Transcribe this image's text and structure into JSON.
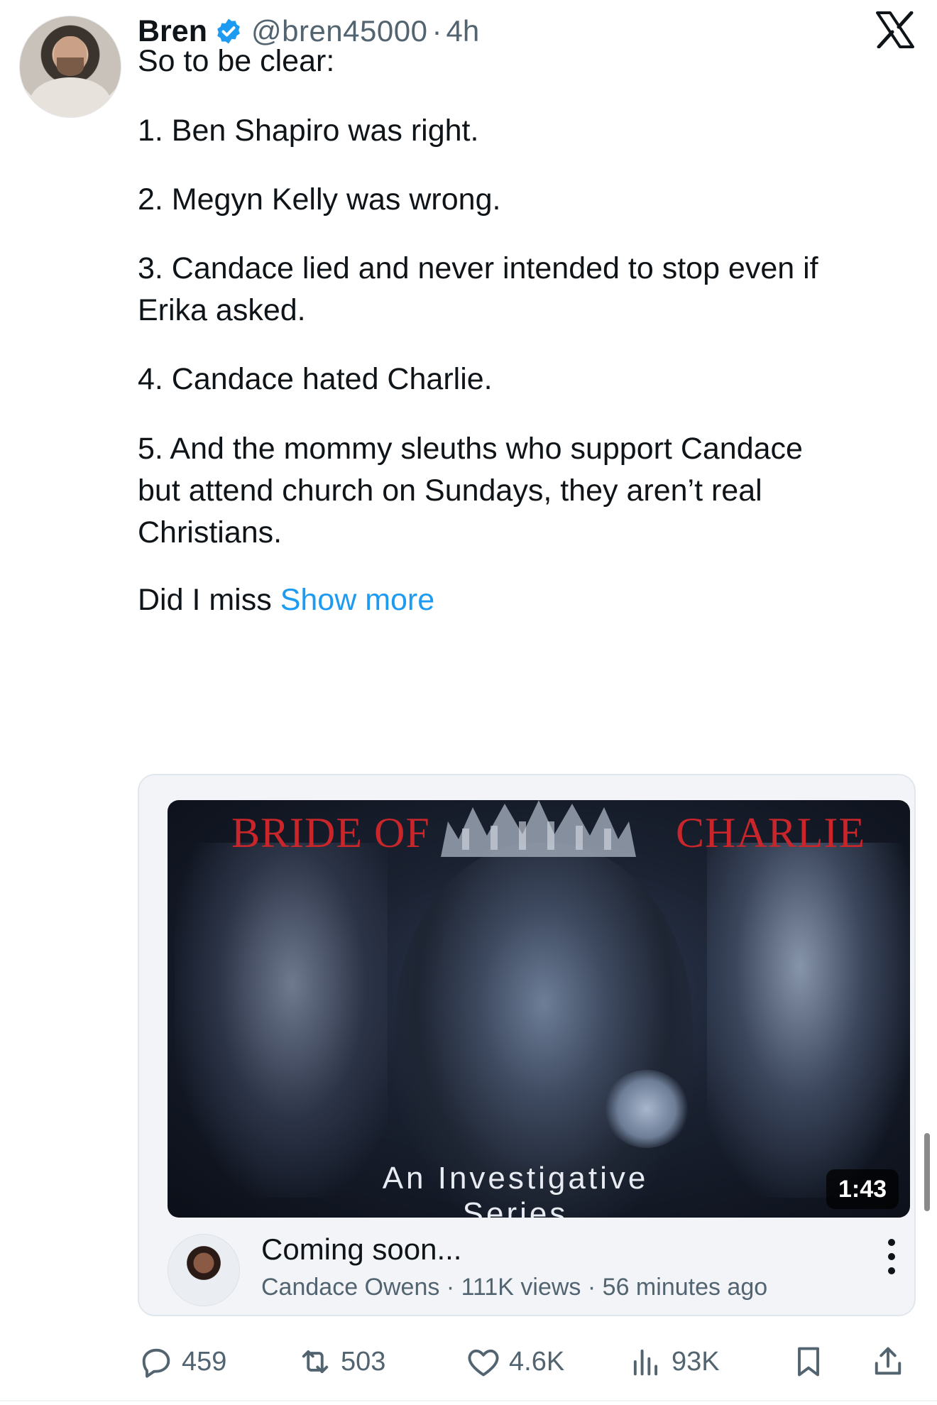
{
  "author": {
    "name": "Bren",
    "handle": "@bren45000",
    "separator": "·",
    "time": "4h",
    "verified": true
  },
  "brand": {
    "logo_icon": "x-logo-icon"
  },
  "tweet": {
    "lines": [
      "So to be clear:",
      "1. Ben Shapiro was right.",
      "2. Megyn Kelly was wrong.",
      "3. Candace lied and never intended to stop even if",
      "Erika asked.",
      "4. Candace hated Charlie.",
      "5. And the mommy sleuths who support Candace",
      "but attend church on Sundays, they aren’t real",
      "Christians.",
      "Did I miss"
    ],
    "show_more": "Show more"
  },
  "card": {
    "thumbnail": {
      "title_left": "BRIDE OF",
      "title_right": "CHARLIE",
      "subtitle": "An Investigative Series",
      "duration": "1:43"
    },
    "title": "Coming soon...",
    "channel": "Candace Owens",
    "views": "111K views",
    "posted": "56 minutes ago",
    "meta_separator": "·"
  },
  "actions": {
    "replies": "459",
    "reposts": "503",
    "likes": "4.6K",
    "views": "93K"
  },
  "colors": {
    "accent": "#1d9bf0",
    "secondary_text": "#536471",
    "title_red": "#c8262b"
  }
}
